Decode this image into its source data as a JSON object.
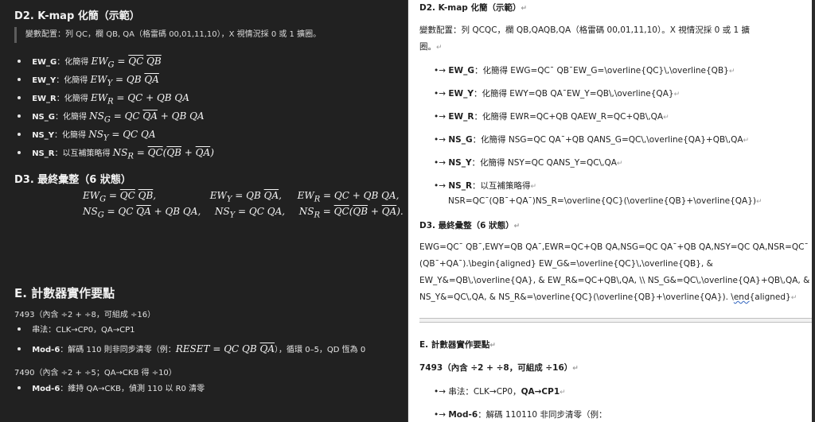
{
  "left": {
    "d2_heading": "D2. K-map 化簡（示範）",
    "quote": "變數配置：列 QC，欄 QB, QA（格雷碼 00,01,11,10），X 視情況採 0 或 1 擴圈。",
    "items": [
      {
        "label": "EW_G",
        "text": "：化簡得 ",
        "math": "EW_G = QC QB"
      },
      {
        "label": "EW_Y",
        "text": "：化簡得 ",
        "math": "EW_Y = QB QA"
      },
      {
        "label": "EW_R",
        "text": "：化簡得 ",
        "math": "EW_R = QC + QB QA"
      },
      {
        "label": "NS_G",
        "text": "：化簡得 ",
        "math": "NS_G = QC QA + QB QA"
      },
      {
        "label": "NS_Y",
        "text": "：化簡得 ",
        "math": "NS_Y = QC QA"
      },
      {
        "label": "NS_R",
        "text": "：以互補策略得 ",
        "math": "NS_R = QC(QB + QA)"
      }
    ],
    "d3_heading": "D3. 最終彙整（6 狀態）",
    "e_heading": "E. 計數器實作要點",
    "ic7493": "7493（內含 ÷2 + ÷8，可組成 ÷16）",
    "serial": "串法：CLK→CP0，QA→CP1",
    "mod6_label": "Mod-6",
    "mod6_text": "：解碼 110 則非同步清零（例：",
    "mod6_math": "RESET = QC QB QA",
    "mod6_tail": "），循環 0–5，QD 恆為 0",
    "ic7490": "7490（內含 ÷2 + ÷5；QA→CKB 得 ÷10）",
    "mod6b_label": "Mod-6",
    "mod6b_text": "：維持 QA→CKB，偵測 110 以 R0 清零"
  },
  "right": {
    "d2_heading": "D2. K-map 化簡（示範）",
    "quote_line1": "變數配置：列 QCQC，欄 QB,QAQB,QA（格雷碼 00,01,11,10）。X 視情況採 0 或 1 擴",
    "quote_line2": "圈。",
    "bullets": [
      {
        "label": "EW_G",
        "text": "：化簡得 EWG=QC¯ QB¯EW_G=\\overline{QC}\\,\\overline{QB}"
      },
      {
        "label": "EW_Y",
        "text": "：化簡得 EWY=QB QA¯EW_Y=QB\\,\\overline{QA}"
      },
      {
        "label": "EW_R",
        "text": "：化簡得 EWR=QC+QB QAEW_R=QC+QB\\,QA"
      },
      {
        "label": "NS_G",
        "text": "：化簡得 NSG=QC QA¯+QB QANS_G=QC\\,\\overline{QA}+QB\\,QA"
      },
      {
        "label": "NS_Y",
        "text": "：化簡得 NSY=QC QANS_Y=QC\\,QA"
      },
      {
        "label": "NS_R",
        "text": "：以互補策略得"
      }
    ],
    "nsr_line2": "NSR=QC¯(QB¯+QA¯)NS_R=\\overline{QC}(\\overline{QB}+\\overline{QA})",
    "d3_heading": "D3. 最終彙整（6 狀態）",
    "d3_p1": "EWG=QC¯ QB¯,EWY=QB QA¯,EWR=QC+QB QA,NSG=QC QA¯+QB QA,NSY=QC QA,NSR=QC¯",
    "d3_p2": "(QB¯+QA¯).\\begin{aligned} EW_G&=\\overline{QC}\\,\\overline{QB}, &",
    "d3_p3": "EW_Y&=QB\\,\\overline{QA}, & EW_R&=QC+QB\\,QA, \\\\ NS_G&=QC\\,\\overline{QA}+QB\\,QA, &",
    "d3_p4a": "NS_Y&=QC\\,QA, & NS_R&=\\overline{QC}(\\overline{QB}+\\overline{QA}). \\",
    "d3_p4b": "end",
    "d3_p4c": "{aligned}",
    "e_heading": "E. 計數器實作要點",
    "ic7493": "7493（內含 ÷2 + ÷8，可組成 ÷16）",
    "serial_text": "串法：CLK→CP0，",
    "serial_bold": "QA→CP1",
    "mod6_label": "Mod-6",
    "mod6_text": "：解碼 110110 非同步清零（例："
  }
}
